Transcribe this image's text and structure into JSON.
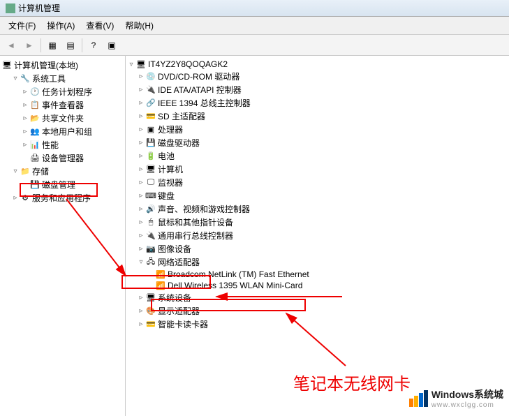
{
  "window": {
    "title": "计算机管理"
  },
  "menu": {
    "file": "文件(F)",
    "action": "操作(A)",
    "view": "查看(V)",
    "help": "帮助(H)"
  },
  "leftTree": {
    "root": "计算机管理(本地)",
    "systemTools": "系统工具",
    "taskScheduler": "任务计划程序",
    "eventViewer": "事件查看器",
    "sharedFolders": "共享文件夹",
    "localUsers": "本地用户和组",
    "performance": "性能",
    "deviceManager": "设备管理器",
    "storage": "存储",
    "diskMgmt": "磁盘管理",
    "servicesApps": "服务和应用程序"
  },
  "rightTree": {
    "root": "IT4YZ2Y8QOQAGK2",
    "cdrom": "DVD/CD-ROM 驱动器",
    "ide": "IDE ATA/ATAPI 控制器",
    "ieee1394": "IEEE 1394 总线主控制器",
    "sd": "SD 主适配器",
    "cpu": "处理器",
    "diskdrive": "磁盘驱动器",
    "battery": "电池",
    "computer": "计算机",
    "monitor": "监视器",
    "keyboard": "键盘",
    "sound": "声音、视频和游戏控制器",
    "mouse": "鼠标和其他指针设备",
    "usb": "通用串行总线控制器",
    "imaging": "图像设备",
    "network": "网络适配器",
    "netcard1": "Broadcom NetLink (TM) Fast Ethernet",
    "netcard2": "Dell Wireless 1395 WLAN Mini-Card",
    "sysdev": "系统设备",
    "display": "显示适配器",
    "smartcard": "智能卡读卡器"
  },
  "annotation": {
    "label": "笔记本无线网卡"
  },
  "watermark": {
    "title": "Windows系统城",
    "url": "www.wxclgg.com"
  }
}
